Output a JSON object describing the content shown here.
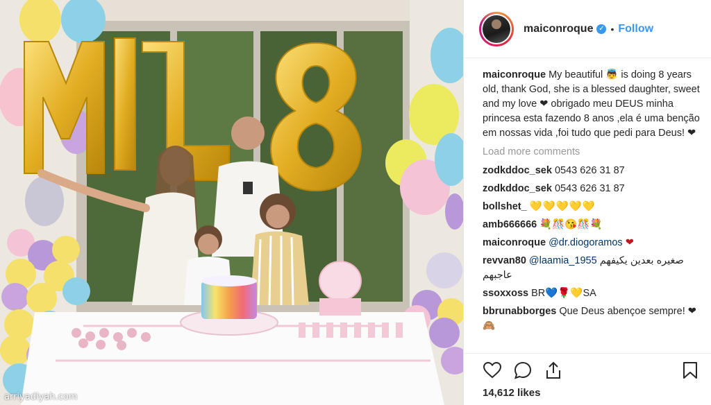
{
  "post": {
    "username": "maiconroque",
    "verified_icon": "verified-badge-icon",
    "follow_label": "Follow",
    "dot": "•",
    "watermark": "arriyadiyah.com"
  },
  "caption": {
    "user": "maiconroque",
    "text": "My beautiful 👼 is doing 8 years old, thank God, she is a blessed daughter, sweet and my love ❤ obrigado meu DEUS minha princesa esta fazendo 8 anos ,ela é uma benção em nossas vida ,foi tudo que pedi para Deus! ❤"
  },
  "load_more": "Load more comments",
  "comments": [
    {
      "user": "zodkddoc_sek",
      "text": "0543 626 31 87"
    },
    {
      "user": "zodkddoc_sek",
      "text": "0543 626 31 87"
    },
    {
      "user": "bollshet_",
      "text": "💛💛💛💛💛"
    },
    {
      "user": "amb666666",
      "text": "💐🎊😘🎊💐"
    },
    {
      "user": "maiconroque",
      "mention": "@dr.diogoramos",
      "text": "❤"
    },
    {
      "user": "revvan80",
      "mention": "@laamia_1955",
      "text": "صغيره بعدين يكيفهم عاجبهم"
    },
    {
      "user": "ssoxxoss",
      "text": "BR💙🌹💛SA"
    },
    {
      "user": "bbrunabborges",
      "text": "Que Deus abençoe sempre! ❤🙈"
    }
  ],
  "actions": {
    "like_icon": "heart-icon",
    "comment_icon": "comment-icon",
    "share_icon": "share-icon",
    "save_icon": "bookmark-icon"
  },
  "likes": "14,612 likes",
  "colors": {
    "link_blue": "#3897f0",
    "mention_blue": "#003569",
    "heart_red": "#c0161f",
    "balloon_gold": "#e7b42a"
  }
}
